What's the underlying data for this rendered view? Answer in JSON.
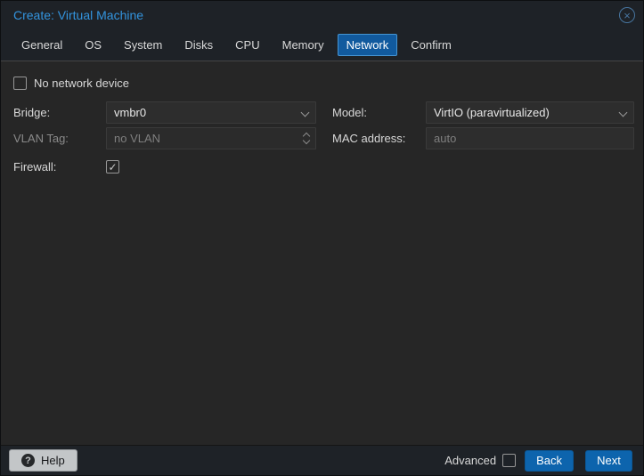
{
  "window": {
    "title": "Create: Virtual Machine"
  },
  "icons": {
    "close": "×",
    "check": "✓",
    "help": "?"
  },
  "tabs": [
    {
      "label": "General",
      "active": false
    },
    {
      "label": "OS",
      "active": false
    },
    {
      "label": "System",
      "active": false
    },
    {
      "label": "Disks",
      "active": false
    },
    {
      "label": "CPU",
      "active": false
    },
    {
      "label": "Memory",
      "active": false
    },
    {
      "label": "Network",
      "active": true
    },
    {
      "label": "Confirm",
      "active": false
    }
  ],
  "form": {
    "no_network_device": {
      "label": "No network device",
      "checked": false
    },
    "bridge": {
      "label": "Bridge:",
      "value": "vmbr0"
    },
    "model": {
      "label": "Model:",
      "value": "VirtIO (paravirtualized)"
    },
    "vlan_tag": {
      "label": "VLAN Tag:",
      "placeholder": "no VLAN",
      "disabled": true
    },
    "mac_address": {
      "label": "MAC address:",
      "placeholder": "auto"
    },
    "firewall": {
      "label": "Firewall:",
      "checked": true
    }
  },
  "footer": {
    "help": "Help",
    "advanced": "Advanced",
    "advanced_checked": false,
    "back": "Back",
    "next": "Next"
  },
  "colors": {
    "title_blue": "#3394de",
    "active_tab_bg": "#115a9e",
    "active_tab_border": "#4695d3",
    "button_blue": "#0d64ad",
    "content_bg": "#262626",
    "chrome_bg": "#1e2227"
  }
}
